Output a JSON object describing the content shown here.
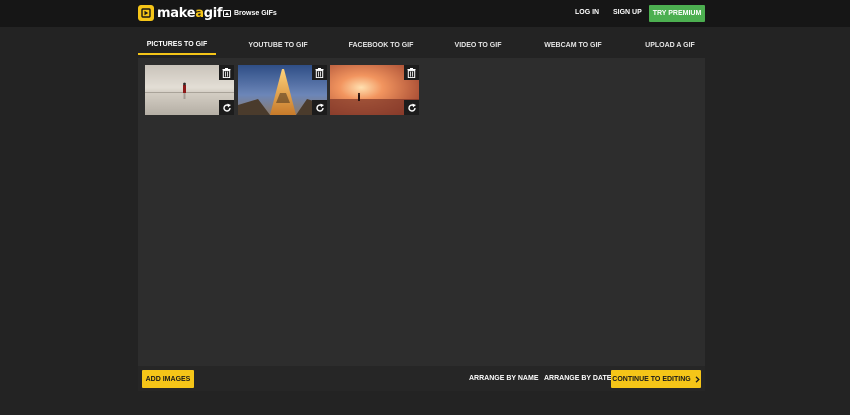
{
  "header": {
    "logo_text_1": "make",
    "logo_text_g": "a",
    "logo_text_2": "gif",
    "browse_label": "Browse GIFs",
    "login_label": "LOG IN",
    "signup_label": "SIGN UP",
    "premium_label": "TRY PREMIUM",
    "premium_color": "#4caf50"
  },
  "tabs": [
    {
      "label": "PICTURES TO GIF",
      "active": true
    },
    {
      "label": "YOUTUBE TO GIF",
      "active": false
    },
    {
      "label": "FACEBOOK TO GIF",
      "active": false
    },
    {
      "label": "VIDEO TO GIF",
      "active": false
    },
    {
      "label": "WEBCAM TO GIF",
      "active": false
    },
    {
      "label": "UPLOAD A GIF",
      "active": false
    }
  ],
  "images": [
    {
      "description_icon": "image-thumbnail",
      "actions": [
        "trash-icon",
        "rotate-icon"
      ]
    },
    {
      "description_icon": "image-thumbnail",
      "actions": [
        "trash-icon",
        "rotate-icon"
      ]
    },
    {
      "description_icon": "image-thumbnail",
      "actions": [
        "trash-icon",
        "rotate-icon"
      ]
    }
  ],
  "actions": {
    "add_images_label": "ADD IMAGES",
    "arrange_name_label": "ARRANGE BY NAME",
    "arrange_date_label": "ARRANGE BY DATE",
    "continue_label": "CONTINUE TO EDITING"
  },
  "colors": {
    "accent": "#f5c518",
    "background": "#232323",
    "panel": "#2d2d2d"
  }
}
